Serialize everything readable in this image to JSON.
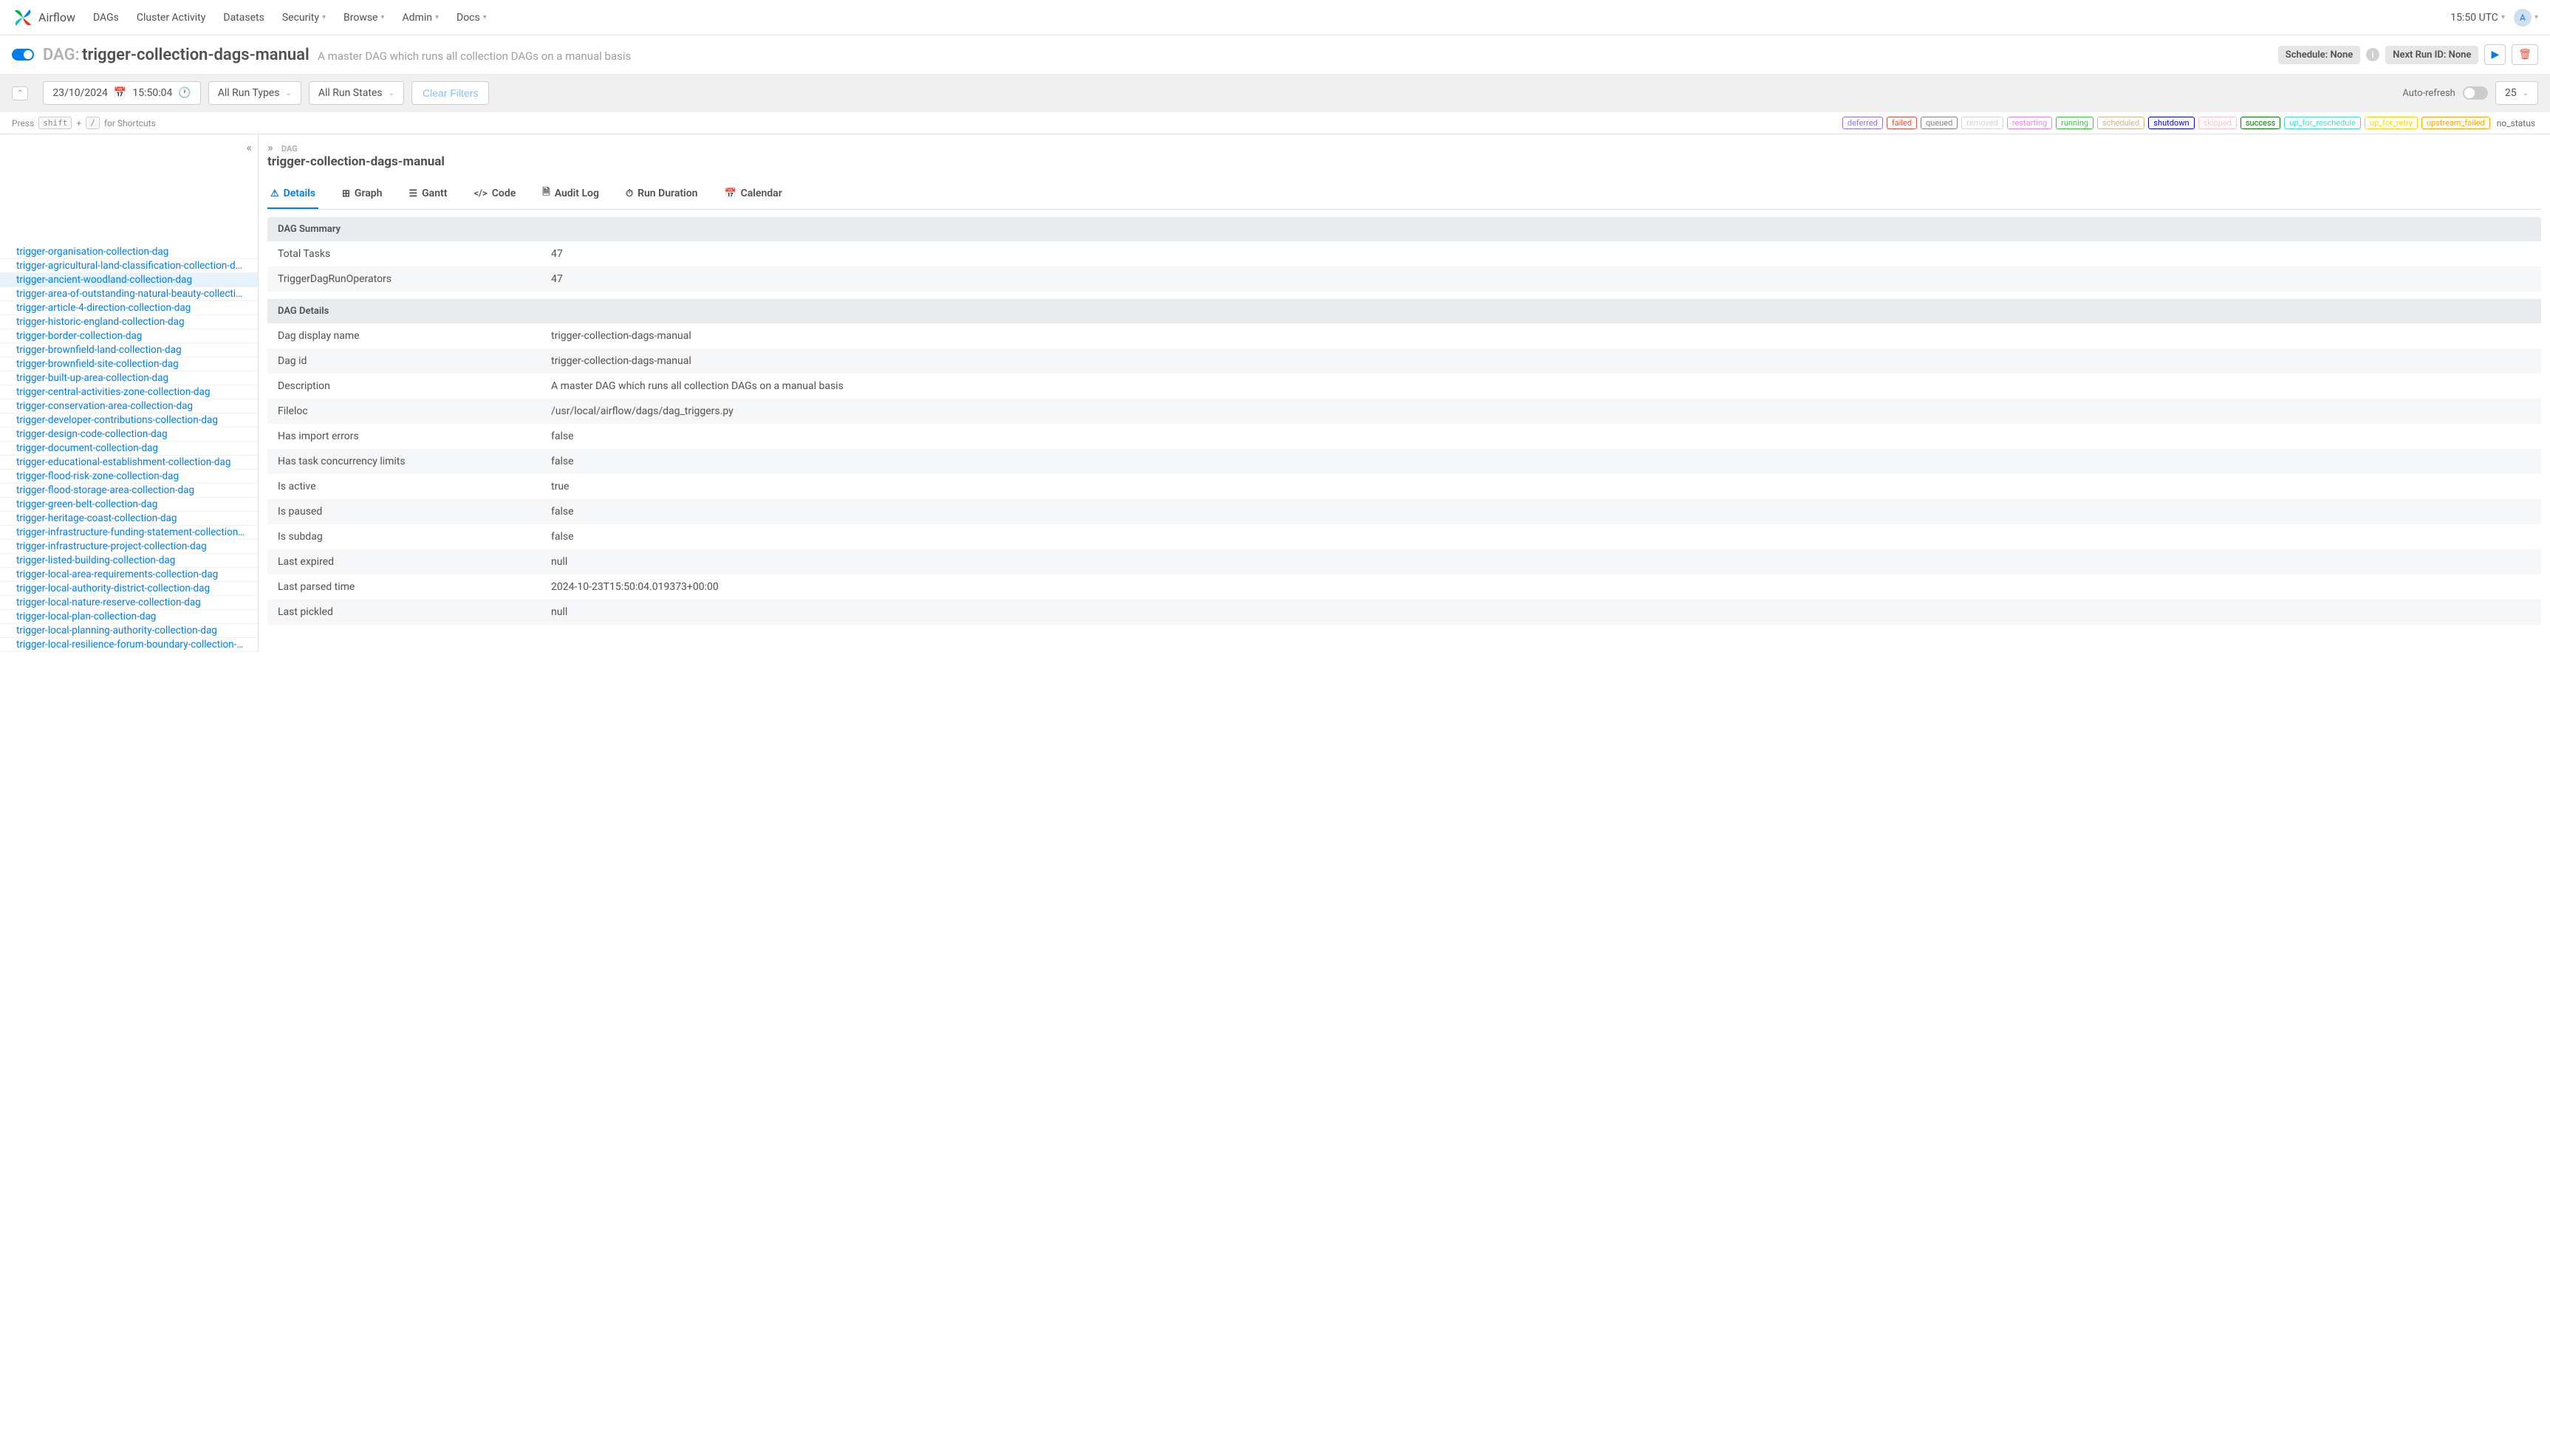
{
  "nav": {
    "brand": "Airflow",
    "items": [
      "DAGs",
      "Cluster Activity",
      "Datasets",
      "Security",
      "Browse",
      "Admin",
      "Docs"
    ],
    "items_dropdown": [
      false,
      false,
      false,
      true,
      true,
      true,
      true
    ],
    "time": "15:50 UTC",
    "avatar_letter": "A"
  },
  "dag": {
    "prefix": "DAG:",
    "name": "trigger-collection-dags-manual",
    "description": "A master DAG which runs all collection DAGs on a manual basis",
    "schedule_label": "Schedule: None",
    "next_run_label": "Next Run ID: None"
  },
  "filters": {
    "date_value": "23/10/2024",
    "time_value": "15:50:04",
    "run_types": "All Run Types",
    "run_states": "All Run States",
    "clear": "Clear Filters",
    "auto_refresh": "Auto-refresh",
    "page_size": "25"
  },
  "shortcuts": {
    "press": "Press",
    "shift": "shift",
    "plus": "+",
    "slash": "/",
    "for": "for Shortcuts"
  },
  "legend": [
    {
      "label": "deferred",
      "color": "#9370db"
    },
    {
      "label": "failed",
      "color": "#e74c3c"
    },
    {
      "label": "queued",
      "color": "#808080"
    },
    {
      "label": "removed",
      "color": "#d3d3d3"
    },
    {
      "label": "restarting",
      "color": "#ee82ee"
    },
    {
      "label": "running",
      "color": "#32cd32"
    },
    {
      "label": "scheduled",
      "color": "#d2b48c"
    },
    {
      "label": "shutdown",
      "color": "#0000ff"
    },
    {
      "label": "skipped",
      "color": "#ffc0cb"
    },
    {
      "label": "success",
      "color": "#008000"
    },
    {
      "label": "up_for_reschedule",
      "color": "#40e0d0"
    },
    {
      "label": "up_for_retry",
      "color": "#ffd700"
    },
    {
      "label": "upstream_failed",
      "color": "#ffa500"
    }
  ],
  "no_status": "no_status",
  "tasks": [
    "trigger-organisation-collection-dag",
    "trigger-agricultural-land-classification-collection-dag",
    "trigger-ancient-woodland-collection-dag",
    "trigger-area-of-outstanding-natural-beauty-collection-dag",
    "trigger-article-4-direction-collection-dag",
    "trigger-historic-england-collection-dag",
    "trigger-border-collection-dag",
    "trigger-brownfield-land-collection-dag",
    "trigger-brownfield-site-collection-dag",
    "trigger-built-up-area-collection-dag",
    "trigger-central-activities-zone-collection-dag",
    "trigger-conservation-area-collection-dag",
    "trigger-developer-contributions-collection-dag",
    "trigger-design-code-collection-dag",
    "trigger-document-collection-dag",
    "trigger-educational-establishment-collection-dag",
    "trigger-flood-risk-zone-collection-dag",
    "trigger-flood-storage-area-collection-dag",
    "trigger-green-belt-collection-dag",
    "trigger-heritage-coast-collection-dag",
    "trigger-infrastructure-funding-statement-collection-dag",
    "trigger-infrastructure-project-collection-dag",
    "trigger-listed-building-collection-dag",
    "trigger-local-area-requirements-collection-dag",
    "trigger-local-authority-district-collection-dag",
    "trigger-local-nature-reserve-collection-dag",
    "trigger-local-plan-collection-dag",
    "trigger-local-planning-authority-collection-dag",
    "trigger-local-resilience-forum-boundary-collection-dag"
  ],
  "selected_task_index": 2,
  "content": {
    "breadcrumb": "DAG",
    "title": "trigger-collection-dags-manual",
    "tabs": [
      "Details",
      "Graph",
      "Gantt",
      "Code",
      "Audit Log",
      "Run Duration",
      "Calendar"
    ],
    "active_tab": 0,
    "summary_header": "DAG Summary",
    "summary_rows": [
      {
        "k": "Total Tasks",
        "v": "47"
      },
      {
        "k": "TriggerDagRunOperators",
        "v": "47"
      }
    ],
    "details_header": "DAG Details",
    "details_rows": [
      {
        "k": "Dag display name",
        "v": "trigger-collection-dags-manual"
      },
      {
        "k": "Dag id",
        "v": "trigger-collection-dags-manual"
      },
      {
        "k": "Description",
        "v": "A master DAG which runs all collection DAGs on a manual basis"
      },
      {
        "k": "Fileloc",
        "v": "/usr/local/airflow/dags/dag_triggers.py"
      },
      {
        "k": "Has import errors",
        "v": "false"
      },
      {
        "k": "Has task concurrency limits",
        "v": "false"
      },
      {
        "k": "Is active",
        "v": "true"
      },
      {
        "k": "Is paused",
        "v": "false"
      },
      {
        "k": "Is subdag",
        "v": "false"
      },
      {
        "k": "Last expired",
        "v": "null"
      },
      {
        "k": "Last parsed time",
        "v": "2024-10-23T15:50:04.019373+00:00"
      },
      {
        "k": "Last pickled",
        "v": "null"
      }
    ]
  }
}
